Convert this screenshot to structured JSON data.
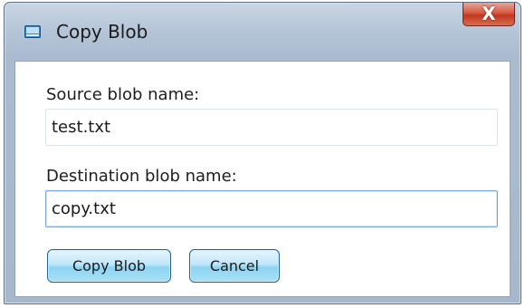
{
  "window": {
    "title": "Copy Blob",
    "icon": "window-app-icon",
    "close_label": "X"
  },
  "form": {
    "source": {
      "label": "Source blob name:",
      "value": "test.txt"
    },
    "destination": {
      "label": "Destination blob name:",
      "value": "copy.txt"
    }
  },
  "buttons": {
    "copy_label": "Copy Blob",
    "cancel_label": "Cancel"
  },
  "colors": {
    "button_gradient_mid": "#8dd4f2",
    "close_red": "#c0391f",
    "focus_border": "#7aa7d6"
  }
}
